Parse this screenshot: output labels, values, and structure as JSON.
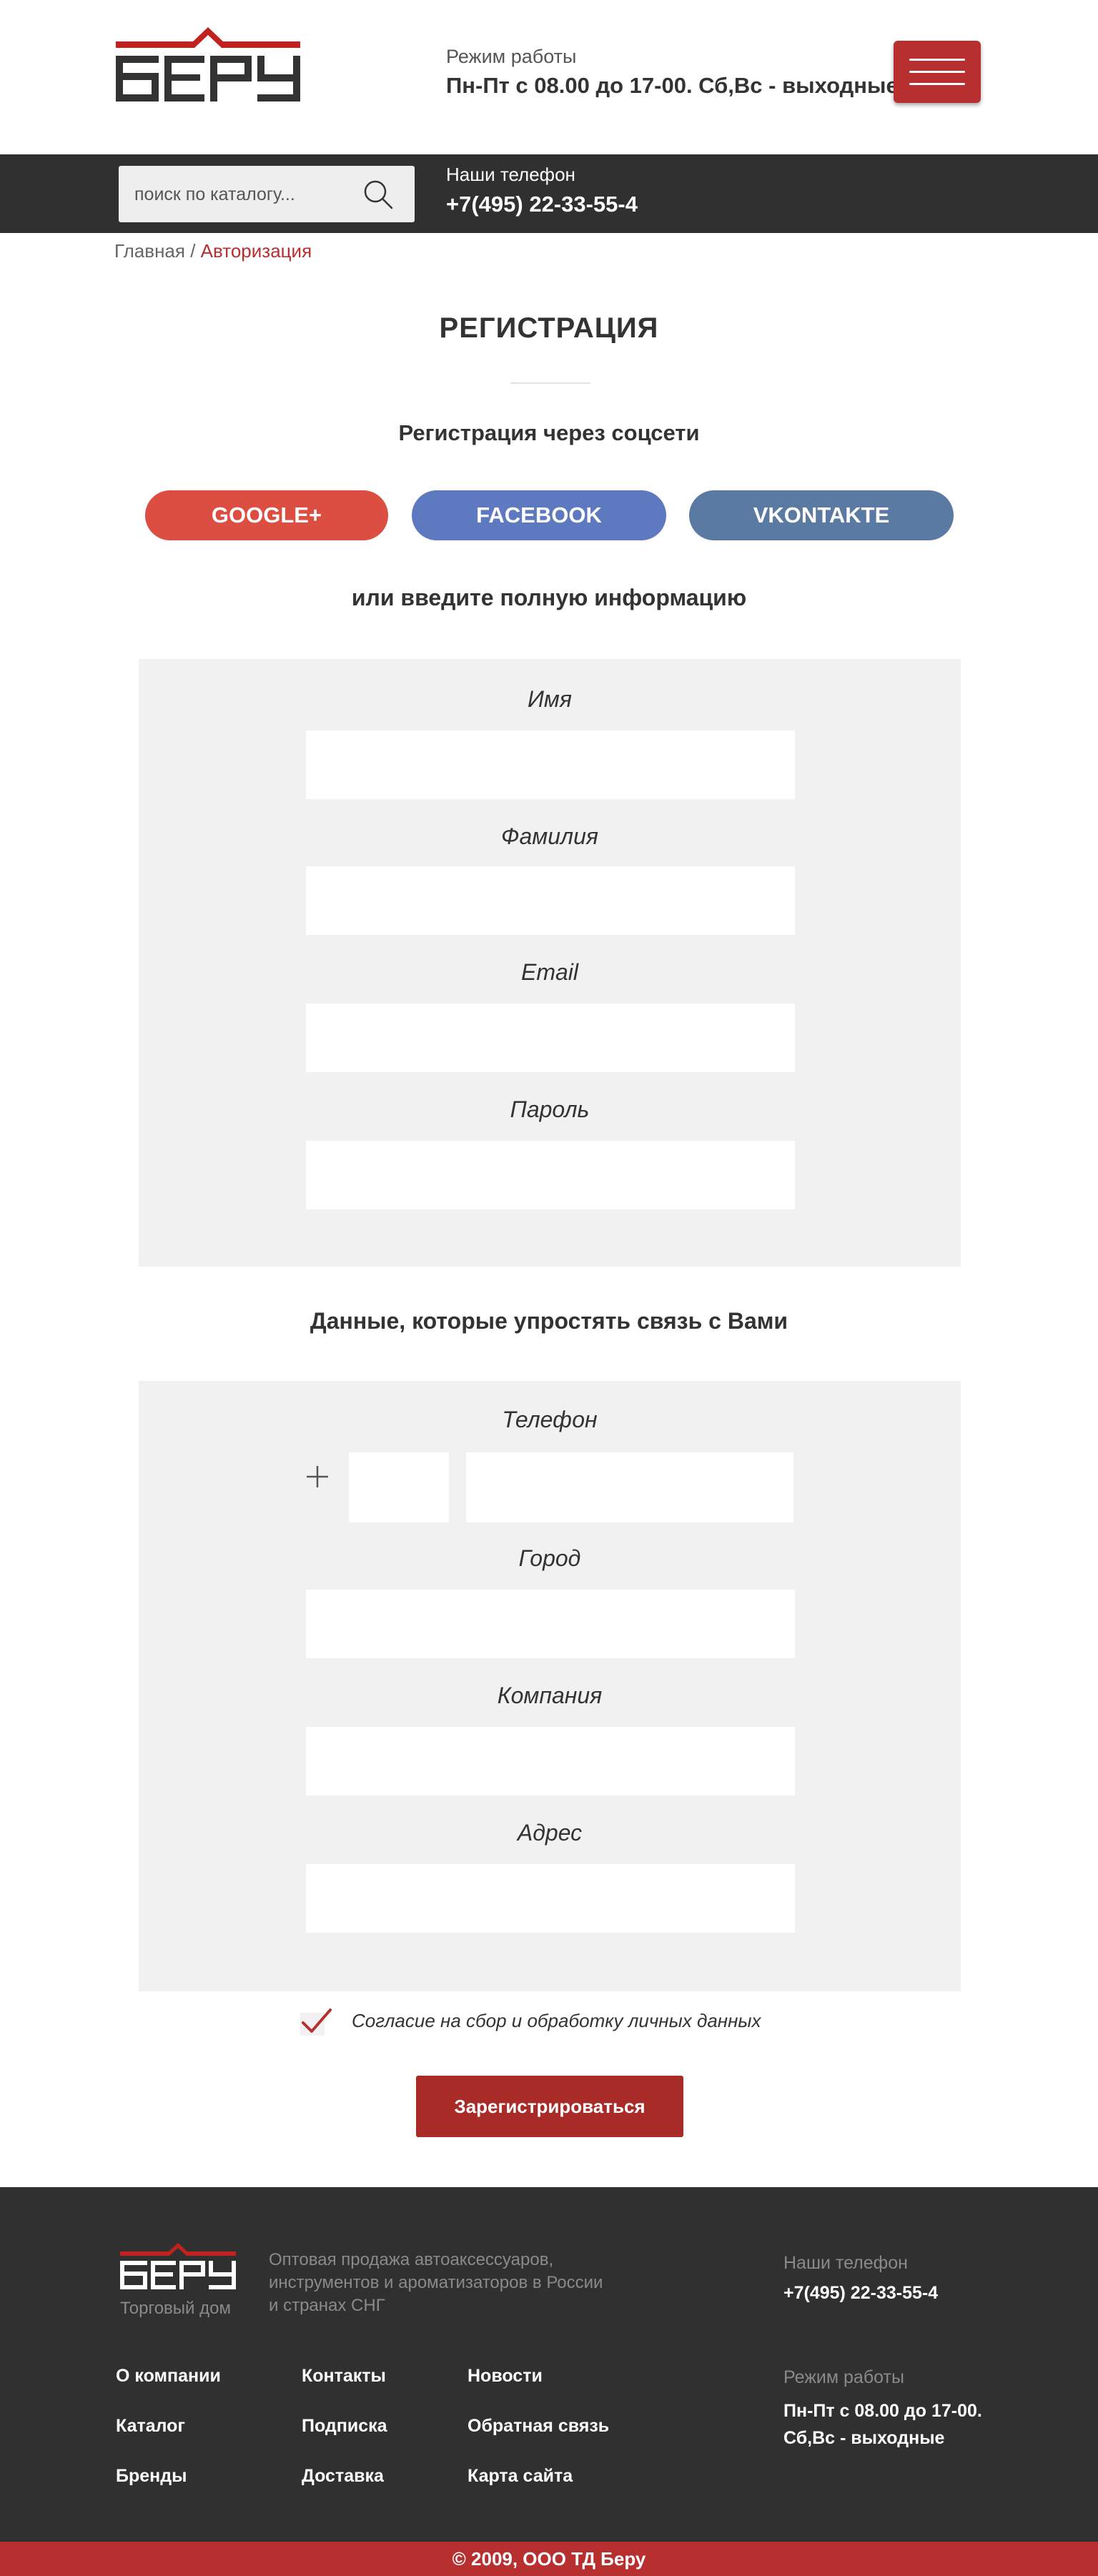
{
  "header": {
    "logo_text": "Беру",
    "hours_label": "Режим работы",
    "hours_value": "Пн-Пт с 08.00 до 17-00. Сб,Вс - выходные"
  },
  "topbar": {
    "search_placeholder": "поиск по каталогу...",
    "phones_label": "Наши телефон",
    "phones_value": "+7(495) 22-33-55-4"
  },
  "breadcrumb": {
    "home": "Главная",
    "separator": " / ",
    "current": "Авторизация"
  },
  "page": {
    "title": "РЕГИСТРАЦИЯ",
    "social_title": "Регистрация через соцсети",
    "social_buttons": [
      {
        "label": "GOOGLE+",
        "color": "#dc4e41"
      },
      {
        "label": "FACEBOOK",
        "color": "#5d79bf"
      },
      {
        "label": "VKONTAKTE",
        "color": "#5a7aa4"
      }
    ],
    "or_title": "или введите полную информацию",
    "main_fields": [
      {
        "label": "Имя",
        "value": ""
      },
      {
        "label": "Фамилия",
        "value": ""
      },
      {
        "label": "Email",
        "value": ""
      },
      {
        "label": "Пароль",
        "value": ""
      }
    ],
    "extra_title": "Данные, которые упростять связь с Вами",
    "extra_fields": [
      {
        "label": "Телефон",
        "prefix": "+",
        "code_value": "",
        "value": ""
      },
      {
        "label": "Город",
        "value": ""
      },
      {
        "label": "Компания",
        "value": ""
      },
      {
        "label": "Адрес",
        "value": ""
      }
    ],
    "consent_text": "Согласие на сбор и обработку личных данных",
    "consent_checked": true,
    "submit_label": "Зарегистрироваться"
  },
  "footer": {
    "logo_sub": "Торговый дом",
    "description": "Оптовая продажа автоаксессуаров, инструментов и ароматизаторов в России и странах СНГ",
    "phones_label": "Наши телефон",
    "phones_value": "+7(495) 22-33-55-4",
    "hours_label": "Режим работы",
    "hours_value": "Пн-Пт с 08.00 до 17-00. Сб,Вс - выходные",
    "links": [
      [
        "О компании",
        "Контакты",
        "Новости"
      ],
      [
        "Каталог",
        "Подписка",
        "Обратная связь"
      ],
      [
        "Бренды",
        "Доставка",
        "Карта сайта"
      ]
    ],
    "copyright": "© 2009, ООО ТД Беру"
  },
  "colors": {
    "accent": "#b7302f",
    "dark": "#303030",
    "panel": "#f1f1f1"
  }
}
